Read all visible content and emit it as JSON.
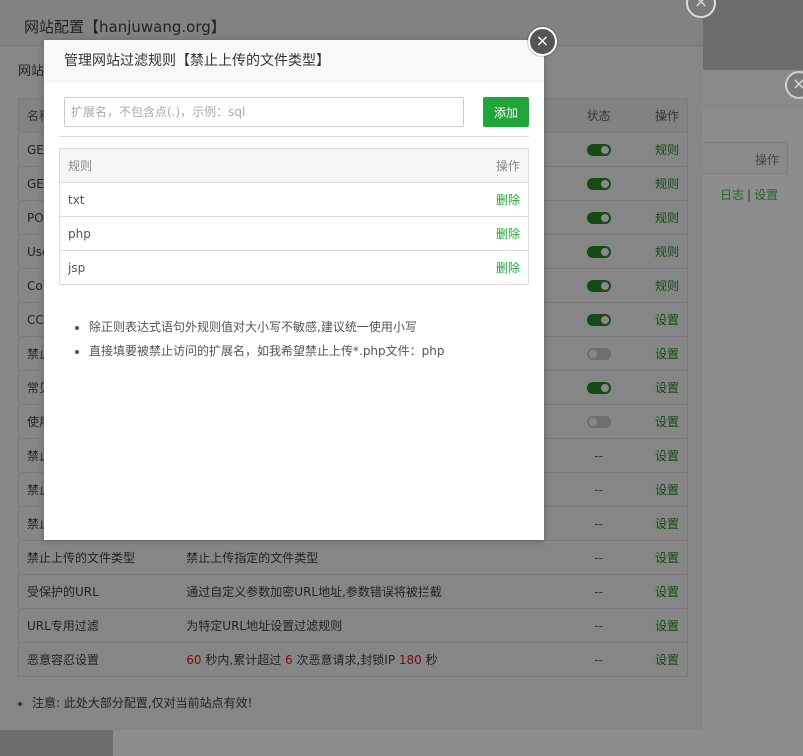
{
  "background": {
    "op_label": "操作",
    "log_link": "日志",
    "separator": "|",
    "settings_link": "设置",
    "close_icon": "×"
  },
  "main": {
    "title": "网站配置【hanjuwang.org】",
    "close_icon": "×",
    "tab_label": "网站",
    "table_headers": {
      "name": "名称",
      "desc": "",
      "status": "状态",
      "op": "操作"
    },
    "rows": [
      {
        "name": "GE",
        "desc": "",
        "status": "on",
        "op": "规则"
      },
      {
        "name": "GE",
        "desc": "",
        "status": "on",
        "op": "规则"
      },
      {
        "name": "PO",
        "desc": "",
        "status": "on",
        "op": "规则"
      },
      {
        "name": "Use",
        "desc": "",
        "status": "on",
        "op": "规则"
      },
      {
        "name": "Co",
        "desc": "",
        "status": "on",
        "op": "规则"
      },
      {
        "name": "CC",
        "desc": "",
        "status": "on",
        "op": "设置"
      },
      {
        "name": "禁止",
        "desc": "",
        "status": "off",
        "op": "设置"
      },
      {
        "name": "常见",
        "desc": "",
        "status": "on",
        "op": "设置"
      },
      {
        "name": "使用",
        "desc": "",
        "status": "off",
        "op": "设置"
      },
      {
        "name": "禁止",
        "desc": "",
        "status": "--",
        "op": "设置"
      },
      {
        "name": "禁止",
        "desc": "",
        "status": "--",
        "op": "设置"
      },
      {
        "name": "禁止",
        "desc": "",
        "status": "--",
        "op": "设置"
      },
      {
        "name": "禁止上传的文件类型",
        "desc": "禁止上传指定的文件类型",
        "status": "--",
        "op": "设置"
      },
      {
        "name": "受保护的URL",
        "desc": "通过自定义参数加密URL地址,参数错误将被拦截",
        "status": "--",
        "op": "设置"
      },
      {
        "name": "URL专用过滤",
        "desc": "为特定URL地址设置过滤规则",
        "status": "--",
        "op": "设置"
      }
    ],
    "last_row": {
      "name": "恶意容忍设置",
      "seconds": "60",
      "text1": " 秒内,累计超过 ",
      "count": "6",
      "text2": " 次恶意请求,封锁IP ",
      "lock": "180",
      "text3": " 秒",
      "status": "--",
      "op": "设置"
    },
    "note": "注意: 此处大部分配置,仅对当前站点有效!"
  },
  "modal": {
    "title": "管理网站过滤规则【禁止上传的文件类型】",
    "close_icon": "×",
    "input_placeholder": "扩展名，不包含点(.)，示例：sql",
    "add_button": "添加",
    "table_headers": {
      "rule": "规则",
      "op": "操作"
    },
    "rules": [
      {
        "rule": "txt",
        "op": "删除"
      },
      {
        "rule": "php",
        "op": "删除"
      },
      {
        "rule": "jsp",
        "op": "删除"
      }
    ],
    "tips": [
      "除正则表达式语句外规则值对大小写不敏感,建议统一使用小写",
      "直接填要被禁止访问的扩展名，如我希望禁止上传*.php文件：php"
    ]
  }
}
